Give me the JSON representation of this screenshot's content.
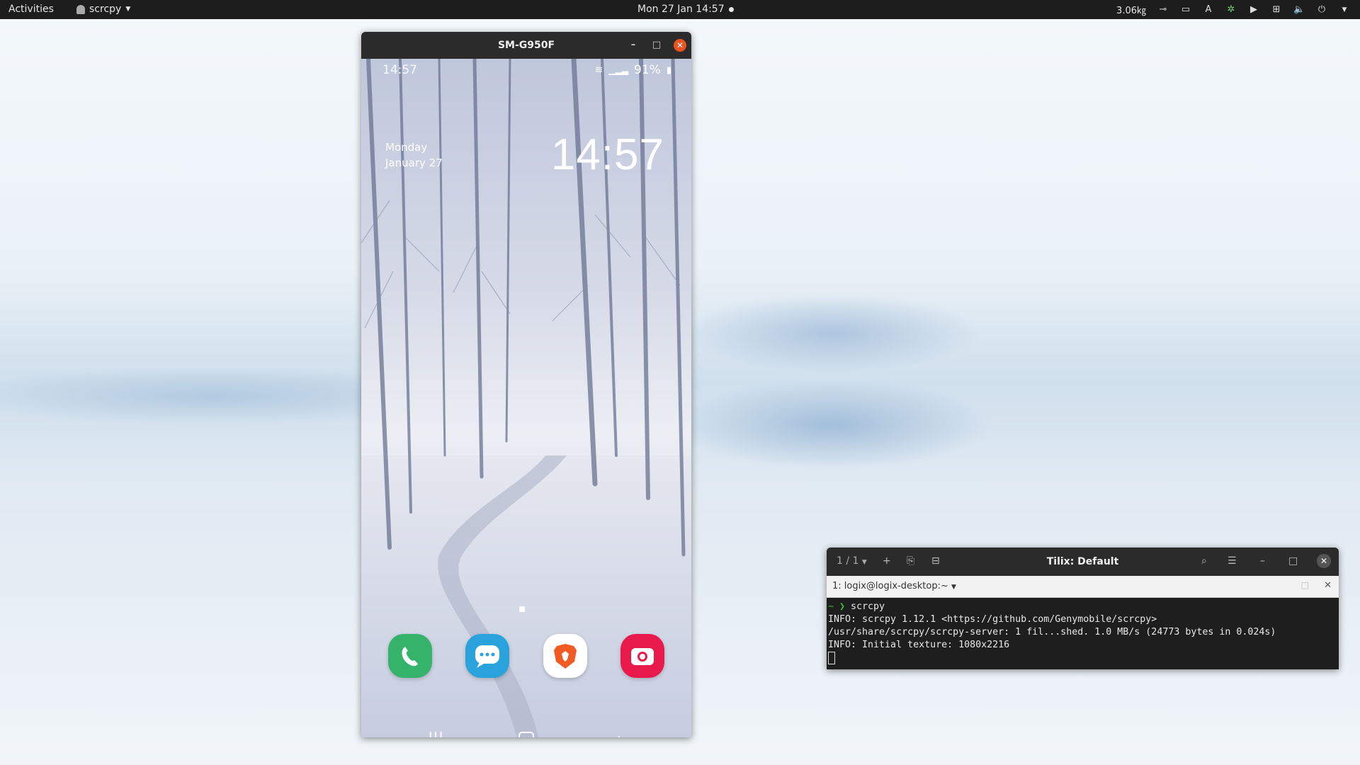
{
  "topbar": {
    "activities": "Activities",
    "app_menu": "scrcpy",
    "clock": "Mon 27 Jan  14:57",
    "net_speed": "3.06㎏"
  },
  "scrcpy_window": {
    "title": "SM-G950F",
    "phone": {
      "status_time": "14:57",
      "battery": "91%",
      "day": "Monday",
      "date": "January 27",
      "clock": "14:57",
      "dock_apps": [
        {
          "name": "Phone",
          "color": "#35b36b"
        },
        {
          "name": "Messages",
          "color": "#2aa3dd"
        },
        {
          "name": "Brave",
          "color": "#ffffff"
        },
        {
          "name": "Camera",
          "color": "#e8194b"
        }
      ]
    }
  },
  "tilix_window": {
    "tab_counter": "1 / 1",
    "title": "Tilix: Default",
    "session_label": "1: logix@logix-desktop:~",
    "command": "scrcpy",
    "output": [
      "INFO: scrcpy 1.12.1 <https://github.com/Genymobile/scrcpy>",
      "/usr/share/scrcpy/scrcpy-server: 1 fil...shed. 1.0 MB/s (24773 bytes in 0.024s)",
      "INFO: Initial texture: 1080x2216"
    ]
  }
}
